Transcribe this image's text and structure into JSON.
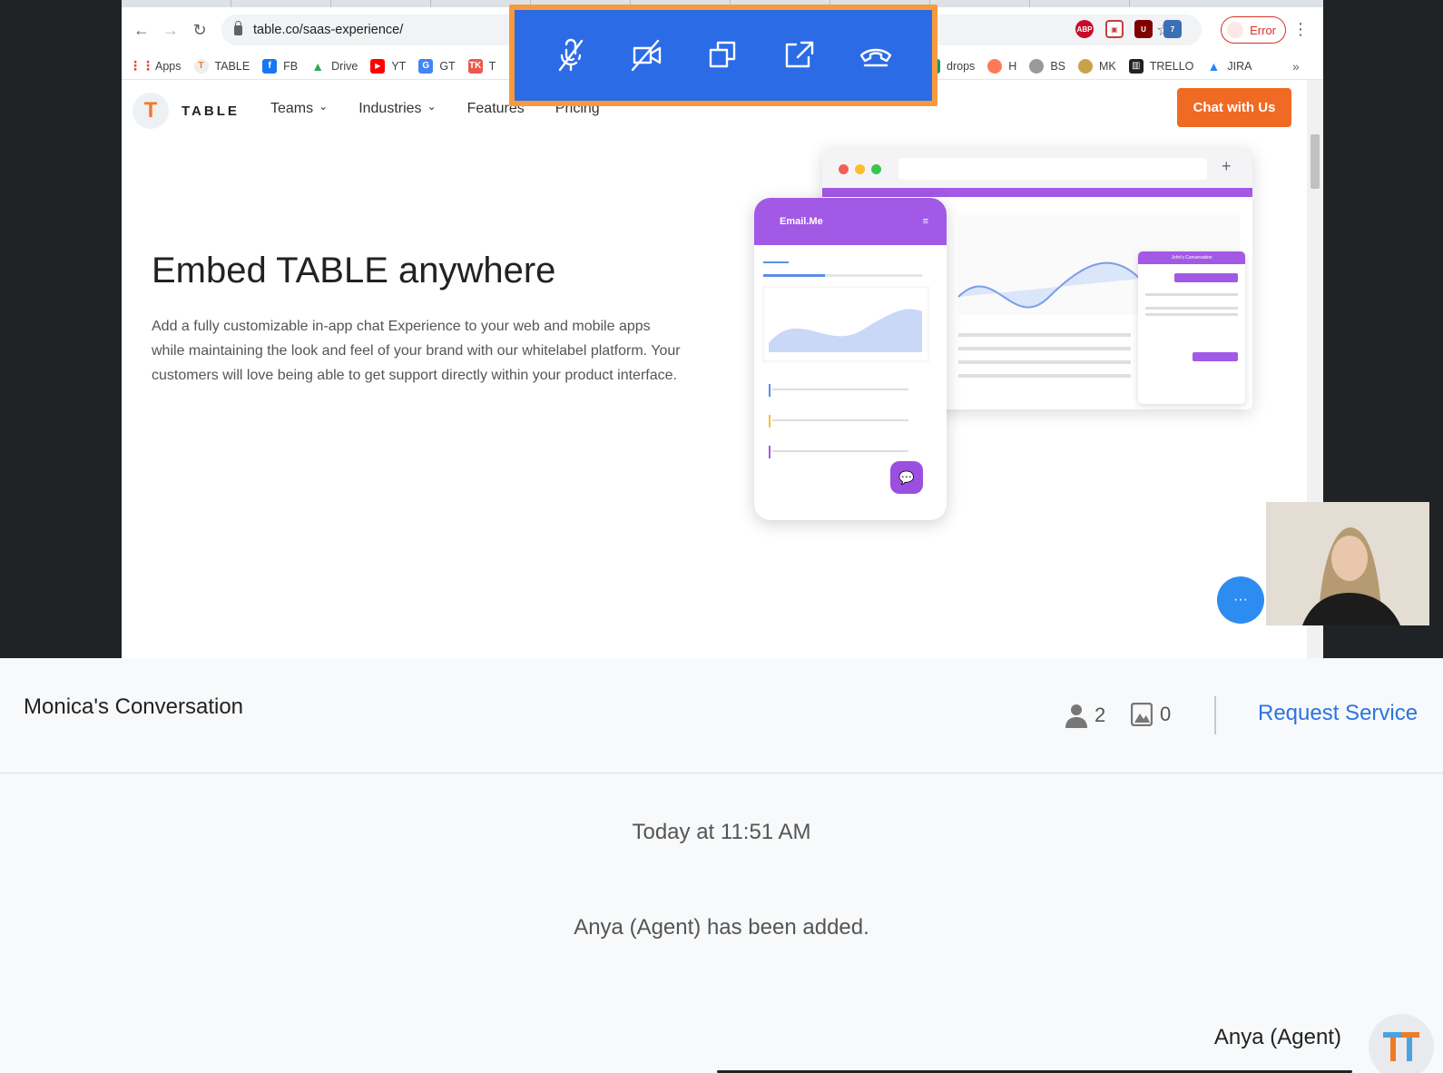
{
  "browser": {
    "url": "table.co/saas-experience/",
    "error_label": "Error",
    "bookmarks": [
      {
        "label": "Apps",
        "icon": "apps-grid-icon",
        "color": "#ea4335"
      },
      {
        "label": "TABLE",
        "icon": "table-logo-icon",
        "color": "#f07a26"
      },
      {
        "label": "FB",
        "icon": "facebook-icon",
        "color": "#1877f2"
      },
      {
        "label": "Drive",
        "icon": "drive-icon",
        "color": "#34a853"
      },
      {
        "label": "YT",
        "icon": "youtube-icon",
        "color": "#ff0000"
      },
      {
        "label": "GT",
        "icon": "translate-icon",
        "color": "#4285f4"
      },
      {
        "label": "T",
        "icon": "tk-icon",
        "color": "#e95950"
      }
    ],
    "bookmarks_right": [
      {
        "label": "drops",
        "icon": "sheets-icon",
        "color": "#0f9d58"
      },
      {
        "label": "H",
        "icon": "hubspot-icon",
        "color": "#ff7a59"
      },
      {
        "label": "BS",
        "icon": "bs-icon",
        "color": "#888888"
      },
      {
        "label": "MK",
        "icon": "mk-icon",
        "color": "#c8a24a"
      },
      {
        "label": "TRELLO",
        "icon": "trello-icon",
        "color": "#222222"
      },
      {
        "label": "JIRA",
        "icon": "jira-icon",
        "color": "#2684ff"
      }
    ]
  },
  "site": {
    "logo_text": "TABLE",
    "nav": [
      "Teams",
      "Industries",
      "Features",
      "Pricing"
    ],
    "cta": "Chat with Us",
    "hero_title": "Embed TABLE anywhere",
    "hero_description": "Add a fully customizable in-app chat Experience to your web and mobile apps while maintaining the look and feel of your brand with our whitelabel platform. Your customers will love being able to get support directly within your product interface.",
    "illustration": {
      "phone_app_title": "Email.Me",
      "chat_card_title": "John's Conversation"
    }
  },
  "call_controls": [
    {
      "name": "mute-mic-button",
      "icon": "mic-off-icon"
    },
    {
      "name": "stop-video-button",
      "icon": "video-off-icon"
    },
    {
      "name": "switch-view-button",
      "icon": "copy-windows-icon"
    },
    {
      "name": "popout-button",
      "icon": "external-link-icon"
    },
    {
      "name": "end-call-button",
      "icon": "hang-up-icon"
    }
  ],
  "conversation": {
    "title": "Monica's Conversation",
    "participants_count": "2",
    "attachments_count": "0",
    "request_service_label": "Request Service",
    "timestamp": "Today at 11:51 AM",
    "system_message": "Anya (Agent) has been added.",
    "sender_name": "Anya (Agent)"
  },
  "colors": {
    "accent_blue": "#2b6be6",
    "control_border": "#f79a3e",
    "cta_orange": "#f06a23",
    "illustration_purple": "#a259e6",
    "link_blue": "#2d73e0"
  }
}
